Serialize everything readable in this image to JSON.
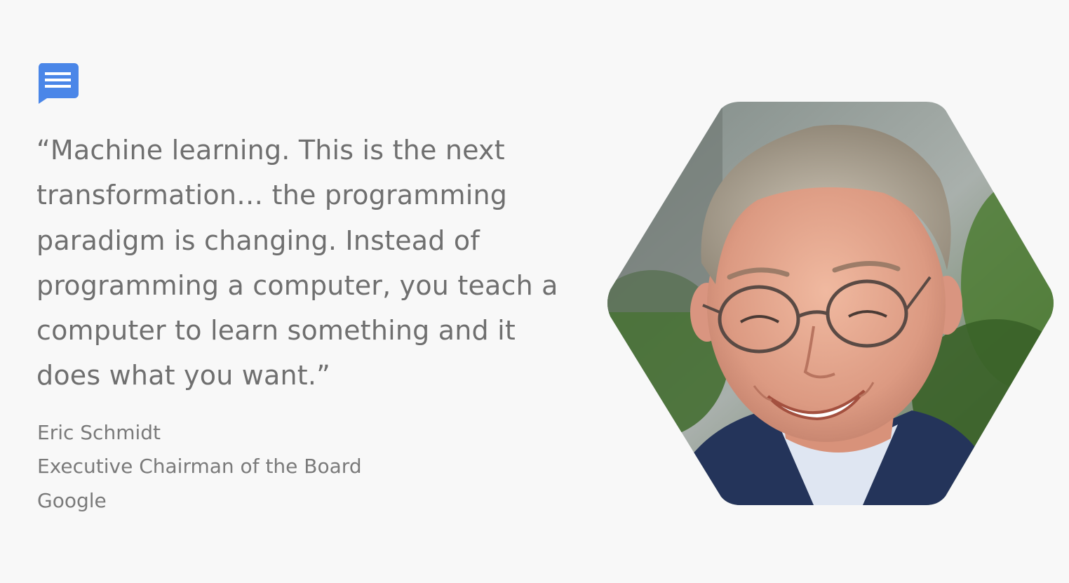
{
  "slide": {
    "icon": "chat-message-icon",
    "accent_color": "#4a86e8",
    "quote": {
      "lines": [
        "“Machine learning. This is the next",
        "transformation… the programming",
        "paradigm is changing. Instead of",
        "programming a computer, you teach a",
        "computer to learn something and it",
        "does what you want.”"
      ]
    },
    "attribution": {
      "name": "Eric Schmidt",
      "title": "Executive Chairman of the Board",
      "company": "Google"
    },
    "portrait": {
      "shape": "hexagon",
      "subject": "smiling man with glasses"
    }
  }
}
